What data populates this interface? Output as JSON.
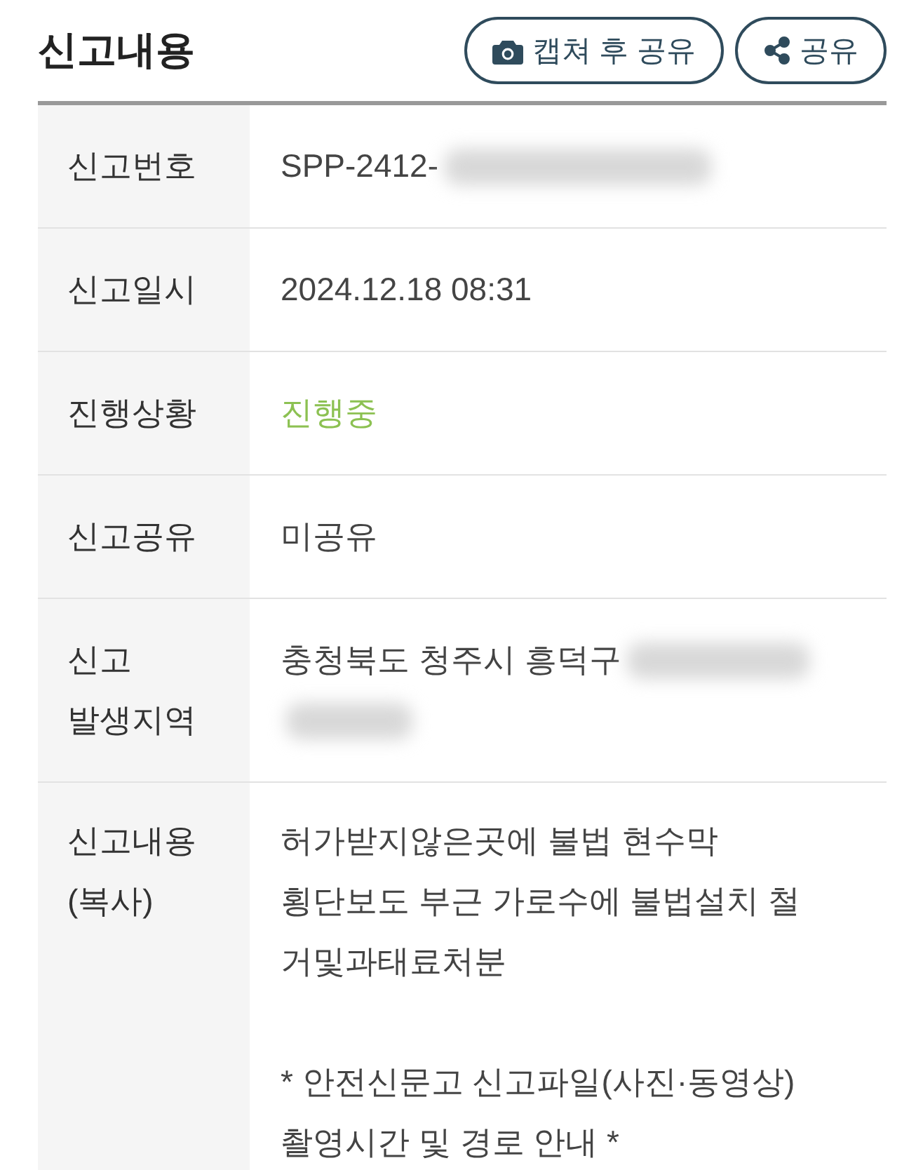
{
  "header": {
    "title": "신고내용",
    "buttons": [
      {
        "kind": "capture",
        "label": "캡쳐 후 공유"
      },
      {
        "kind": "share",
        "label": "공유"
      }
    ]
  },
  "rows": [
    {
      "kind": "plain",
      "label": [
        "신고번호"
      ],
      "paragraphs": [
        [
          "SPP-2412-"
        ]
      ],
      "redacted": true
    },
    {
      "kind": "plain",
      "label": [
        "신고일시"
      ],
      "paragraphs": [
        [
          "2024.12.18 08:31"
        ]
      ]
    },
    {
      "kind": "status",
      "label": [
        "진행상황"
      ],
      "paragraphs": [
        [
          "진행중"
        ]
      ]
    },
    {
      "kind": "plain",
      "label": [
        "신고공유"
      ],
      "paragraphs": [
        [
          "미공유"
        ]
      ]
    },
    {
      "kind": "address",
      "label": [
        "신고",
        "발생지역"
      ],
      "paragraphs": [
        [
          "충청북도 청주시 흥덕구"
        ]
      ],
      "redacted": true
    },
    {
      "kind": "content",
      "label": [
        "신고내용",
        "(복사)"
      ],
      "paragraphs": [
        [
          "허가받지않은곳에 불법 현수막",
          "횡단보도 부근 가로수에 불법설치 철",
          "거및과태료처분"
        ],
        [
          "* 안전신문고 신고파일(사진·동영상)",
          "촬영시간 및 경로 안내 *"
        ]
      ]
    }
  ]
}
